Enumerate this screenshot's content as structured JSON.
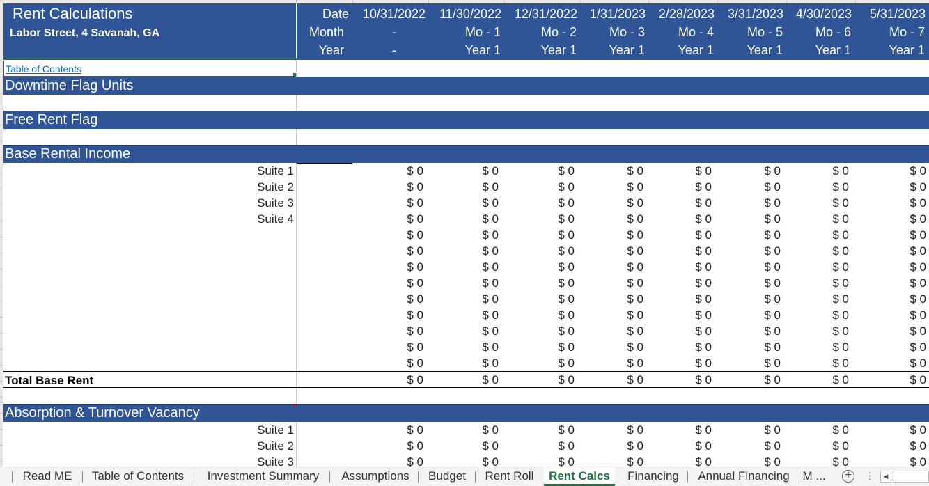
{
  "title": "Rent Calculations",
  "address": "Labor Street, 4 Savanah, GA",
  "header_labels": [
    "Date",
    "Month",
    "Year"
  ],
  "first_col": {
    "month": "-",
    "year": "-"
  },
  "periods": [
    {
      "date": "10/31/2022",
      "month": "Mo - 1",
      "year": "Year 1"
    },
    {
      "date": "11/30/2022",
      "month": "Mo - 2",
      "year": "Year 1"
    },
    {
      "date": "12/31/2022",
      "month": "Mo - 3",
      "year": "Year 1"
    },
    {
      "date": "1/31/2023",
      "month": "Mo - 4",
      "year": "Year 1"
    },
    {
      "date": "2/28/2023",
      "month": "Mo - 5",
      "year": "Year 1"
    },
    {
      "date": "3/31/2023",
      "month": "Mo - 6",
      "year": "Year 1"
    },
    {
      "date": "4/30/2023",
      "month": "Mo - 7",
      "year": "Year 1"
    },
    {
      "date": "5/31/2023"
    }
  ],
  "toc_link": "Table of Contents",
  "sections": {
    "downtime": "Downtime Flag Units",
    "free_rent": "Free Rent Flag",
    "base_rental": "Base Rental Income",
    "absorption": "Absorption & Turnover Vacancy"
  },
  "base_rent_rows": [
    {
      "label": "Suite 1",
      "values": [
        "$ 0",
        "$ 0",
        "$ 0",
        "$ 0",
        "$ 0",
        "$ 0",
        "$ 0",
        "$ 0"
      ]
    },
    {
      "label": "Suite 2",
      "values": [
        "$ 0",
        "$ 0",
        "$ 0",
        "$ 0",
        "$ 0",
        "$ 0",
        "$ 0",
        "$ 0"
      ]
    },
    {
      "label": "Suite 3",
      "values": [
        "$ 0",
        "$ 0",
        "$ 0",
        "$ 0",
        "$ 0",
        "$ 0",
        "$ 0",
        "$ 0"
      ]
    },
    {
      "label": "Suite 4",
      "values": [
        "$ 0",
        "$ 0",
        "$ 0",
        "$ 0",
        "$ 0",
        "$ 0",
        "$ 0",
        "$ 0"
      ]
    },
    {
      "label": "",
      "values": [
        "$ 0",
        "$ 0",
        "$ 0",
        "$ 0",
        "$ 0",
        "$ 0",
        "$ 0",
        "$ 0"
      ]
    },
    {
      "label": "",
      "values": [
        "$ 0",
        "$ 0",
        "$ 0",
        "$ 0",
        "$ 0",
        "$ 0",
        "$ 0",
        "$ 0"
      ]
    },
    {
      "label": "",
      "values": [
        "$ 0",
        "$ 0",
        "$ 0",
        "$ 0",
        "$ 0",
        "$ 0",
        "$ 0",
        "$ 0"
      ]
    },
    {
      "label": "",
      "values": [
        "$ 0",
        "$ 0",
        "$ 0",
        "$ 0",
        "$ 0",
        "$ 0",
        "$ 0",
        "$ 0"
      ]
    },
    {
      "label": "",
      "values": [
        "$ 0",
        "$ 0",
        "$ 0",
        "$ 0",
        "$ 0",
        "$ 0",
        "$ 0",
        "$ 0"
      ]
    },
    {
      "label": "",
      "values": [
        "$ 0",
        "$ 0",
        "$ 0",
        "$ 0",
        "$ 0",
        "$ 0",
        "$ 0",
        "$ 0"
      ]
    },
    {
      "label": "",
      "values": [
        "$ 0",
        "$ 0",
        "$ 0",
        "$ 0",
        "$ 0",
        "$ 0",
        "$ 0",
        "$ 0"
      ]
    },
    {
      "label": "",
      "values": [
        "$ 0",
        "$ 0",
        "$ 0",
        "$ 0",
        "$ 0",
        "$ 0",
        "$ 0",
        "$ 0"
      ]
    },
    {
      "label": "",
      "values": [
        "$ 0",
        "$ 0",
        "$ 0",
        "$ 0",
        "$ 0",
        "$ 0",
        "$ 0",
        "$ 0"
      ]
    }
  ],
  "total_base_rent": {
    "label": "Total Base Rent",
    "values": [
      "$ 0",
      "$ 0",
      "$ 0",
      "$ 0",
      "$ 0",
      "$ 0",
      "$ 0",
      "$ 0"
    ]
  },
  "absorption_rows": [
    {
      "label": "Suite 1",
      "values": [
        "$ 0",
        "$ 0",
        "$ 0",
        "$ 0",
        "$ 0",
        "$ 0",
        "$ 0",
        "$ 0"
      ]
    },
    {
      "label": "Suite 2",
      "values": [
        "$ 0",
        "$ 0",
        "$ 0",
        "$ 0",
        "$ 0",
        "$ 0",
        "$ 0",
        "$ 0"
      ]
    },
    {
      "label": "Suite 3",
      "values": [
        "$ 0",
        "$ 0",
        "$ 0",
        "$ 0",
        "$ 0",
        "$ 0",
        "$ 0",
        "$ 0"
      ]
    }
  ],
  "tabs": [
    {
      "label": "Read ME"
    },
    {
      "label": "Table of Contents"
    },
    {
      "label": "Investment Summary"
    },
    {
      "label": "Assumptions"
    },
    {
      "label": "Budget"
    },
    {
      "label": "Rent Roll"
    },
    {
      "label": "Rent Calcs",
      "active": true
    },
    {
      "label": "Financing"
    },
    {
      "label": "Annual Financing"
    },
    {
      "label": "M ..."
    }
  ],
  "tab_controls": {
    "add_symbol": "+",
    "more_symbol": "⋮",
    "scroll_left_symbol": "◀"
  }
}
